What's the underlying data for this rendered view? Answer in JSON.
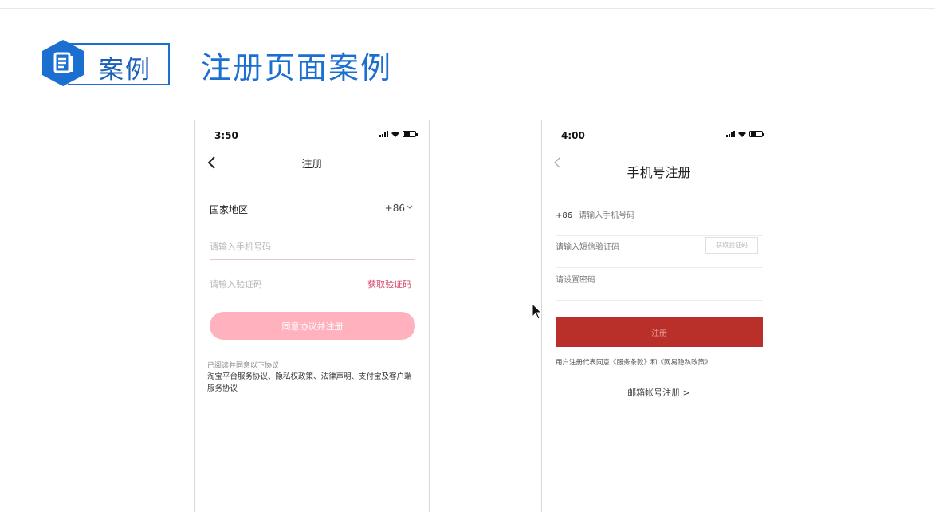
{
  "header": {
    "badge_label": "案例",
    "title": "注册页面案例",
    "badge_icon": "document-icon",
    "accent_color": "#1a6fd0"
  },
  "left_phone": {
    "status_time": "3:50",
    "nav_title": "注册",
    "region_label": "国家地区",
    "region_code": "+86",
    "phone_placeholder": "请输入手机号码",
    "code_placeholder": "请输入验证码",
    "get_code_label": "获取验证码",
    "submit_label": "同意协议并注册",
    "agreement_intro": "已阅读并同意以下协议",
    "agreement_list": "淘宝平台服务协议、隐私权政策、法律声明、支付宝及客户端服务协议",
    "accent_color": "#d6476b",
    "button_color": "#ffb1bd"
  },
  "right_phone": {
    "status_time": "4:00",
    "nav_title": "手机号注册",
    "country_code": "+86",
    "phone_placeholder": "请输入手机号码",
    "sms_placeholder": "请输入短信验证码",
    "get_code_label": "获取验证码",
    "password_placeholder": "请设置密码",
    "submit_label": "注册",
    "terms": "用户注册代表同意《服务条款》和《网易隐私政策》",
    "email_register_label": "邮箱帐号注册 >",
    "button_color": "#b9302b"
  }
}
